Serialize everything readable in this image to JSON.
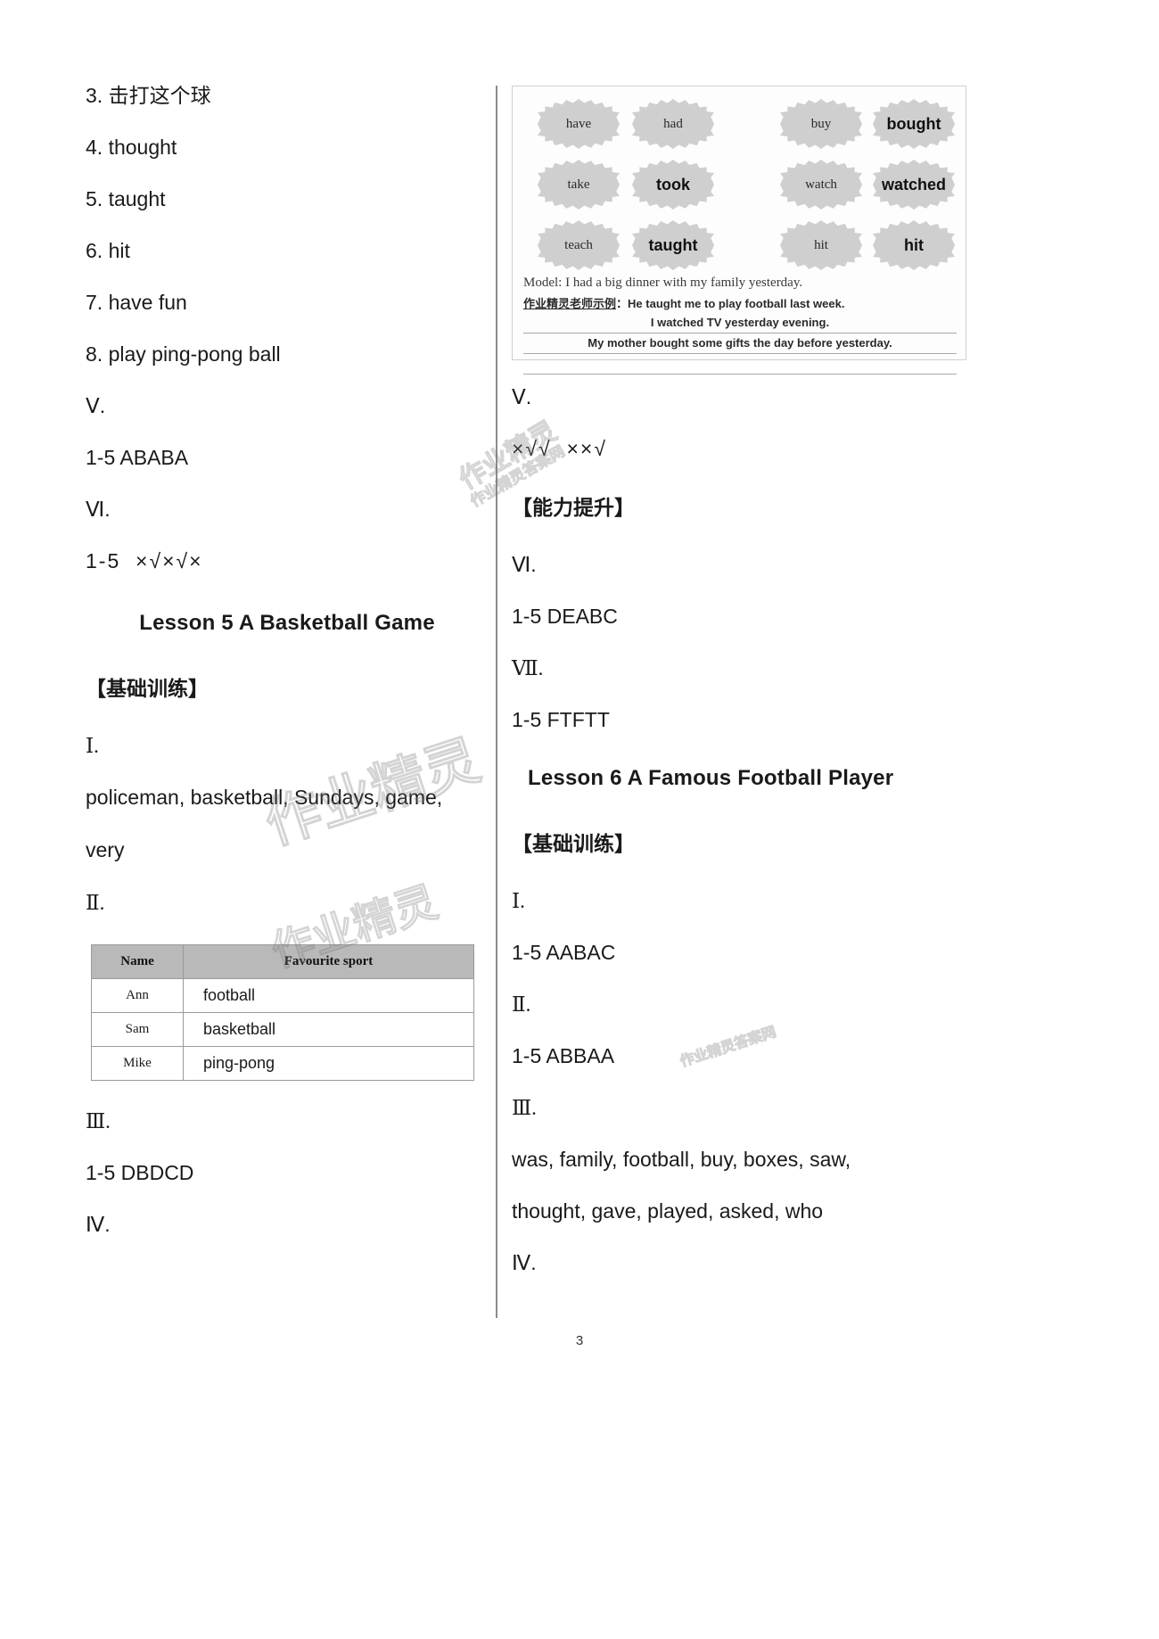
{
  "page": {
    "number": "3"
  },
  "watermark": {
    "text": "作业精灵",
    "sub": "作业精灵答案网"
  },
  "left_column": {
    "answers_top": [
      "3. 击打这个球",
      "4. thought",
      "5. taught",
      "6. hit",
      "7. have fun",
      "8. play ping-pong ball"
    ],
    "section_v_label": "Ⅴ.",
    "section_v_answer": "1-5 ABABA",
    "section_vi_label": "Ⅵ.",
    "section_vi_answer": "1-5  ×√×√×",
    "lesson_title": "Lesson 5 A Basketball Game",
    "basic_training_label": "【基础训练】",
    "section_i_label": "Ⅰ.",
    "section_i_words_line1": "policeman, basketball, Sundays, game,",
    "section_i_words_line2": "very",
    "section_ii_label": "Ⅱ.",
    "table": {
      "headers": [
        "Name",
        "Favourite sport"
      ],
      "rows": [
        {
          "name": "Ann",
          "sport": "football"
        },
        {
          "name": "Sam",
          "sport": "basketball"
        },
        {
          "name": "Mike",
          "sport": "ping-pong"
        }
      ]
    },
    "section_iii_label": "Ⅲ.",
    "section_iii_answer": "1-5 DBDCD",
    "section_iv_label": "Ⅳ."
  },
  "right_column": {
    "figure": {
      "badges": [
        {
          "text": "have",
          "answer": false,
          "row": 0,
          "col": 0
        },
        {
          "text": "had",
          "answer": false,
          "row": 0,
          "col": 1
        },
        {
          "text": "buy",
          "answer": false,
          "row": 0,
          "col": 2
        },
        {
          "text": "bought",
          "answer": true,
          "row": 0,
          "col": 3
        },
        {
          "text": "take",
          "answer": false,
          "row": 1,
          "col": 0
        },
        {
          "text": "took",
          "answer": true,
          "row": 1,
          "col": 1
        },
        {
          "text": "watch",
          "answer": false,
          "row": 1,
          "col": 2
        },
        {
          "text": "watched",
          "answer": true,
          "row": 1,
          "col": 3
        },
        {
          "text": "teach",
          "answer": false,
          "row": 2,
          "col": 0
        },
        {
          "text": "taught",
          "answer": true,
          "row": 2,
          "col": 1
        },
        {
          "text": "hit",
          "answer": false,
          "row": 2,
          "col": 2
        },
        {
          "text": "hit",
          "answer": true,
          "row": 2,
          "col": 3
        }
      ],
      "model_sentence": "Model: I had a big dinner with my family yesterday.",
      "teacher_label": "作业精灵老师示例",
      "teacher_separator": "：",
      "teacher_sentence": "He taught me to play football last week.",
      "written_line_1": "I watched TV yesterday evening.",
      "written_line_2": "My mother bought some gifts the day before yesterday."
    },
    "section_v_label": "Ⅴ.",
    "section_v_answer": "×√√  ××√",
    "ability_label": "【能力提升】",
    "section_vi_label": "Ⅵ.",
    "section_vi_answer": "1-5 DEABC",
    "section_vii_label": "Ⅶ.",
    "section_vii_answer": "1-5 FTFTT",
    "lesson_title": "Lesson 6 A Famous Football Player",
    "basic_training_label": "【基础训练】",
    "section_i_label": "Ⅰ.",
    "section_i_answer": "1-5 AABAC",
    "section_ii_label": "Ⅱ.",
    "section_ii_answer": "1-5 ABBAA",
    "section_iii_label": "Ⅲ.",
    "section_iii_line1": "was, family, football, buy, boxes, saw,",
    "section_iii_line2": "thought, gave, played, asked, who",
    "section_iv_label": "Ⅳ."
  }
}
